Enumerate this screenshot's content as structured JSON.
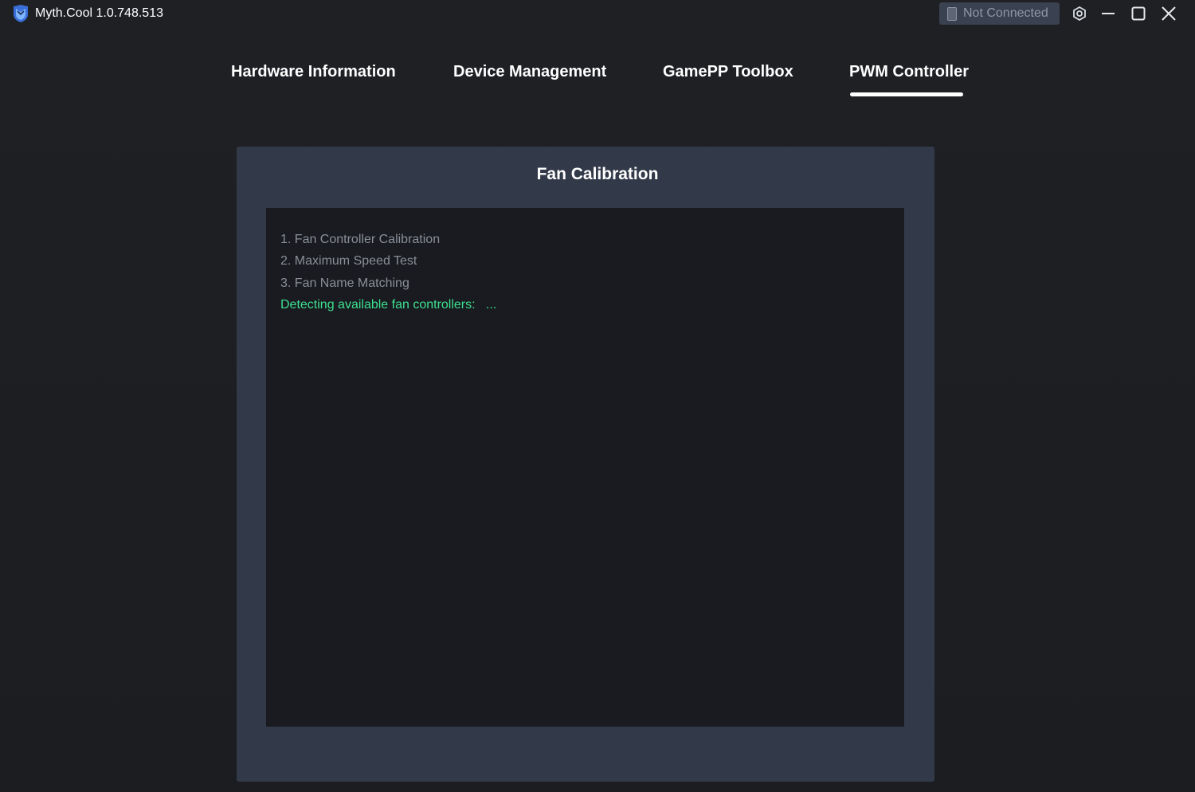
{
  "app": {
    "title": "Myth.Cool  1.0.748.513",
    "connection_status": "Not Connected"
  },
  "icons": {
    "logo": "app-logo-icon",
    "connection": "phone-icon",
    "settings": "settings-hex-icon",
    "minimize": "minimize-icon",
    "maximize": "maximize-icon",
    "close": "close-icon"
  },
  "tabs": [
    {
      "label": "Hardware Information",
      "active": false
    },
    {
      "label": "Device Management",
      "active": false
    },
    {
      "label": "GamePP Toolbox",
      "active": false
    },
    {
      "label": "PWM Controller",
      "active": true
    }
  ],
  "panel": {
    "title": "Fan Calibration",
    "log_lines": [
      "1. Fan Controller Calibration",
      "2. Maximum Speed Test",
      "3. Fan Name Matching",
      "Detecting available fan controllers:   ..."
    ]
  },
  "colors": {
    "background": "#1c1e22",
    "panel": "#323a4a",
    "log_background": "#191b20",
    "log_text": "#8a8f98",
    "status_green": "#3ee08f"
  }
}
